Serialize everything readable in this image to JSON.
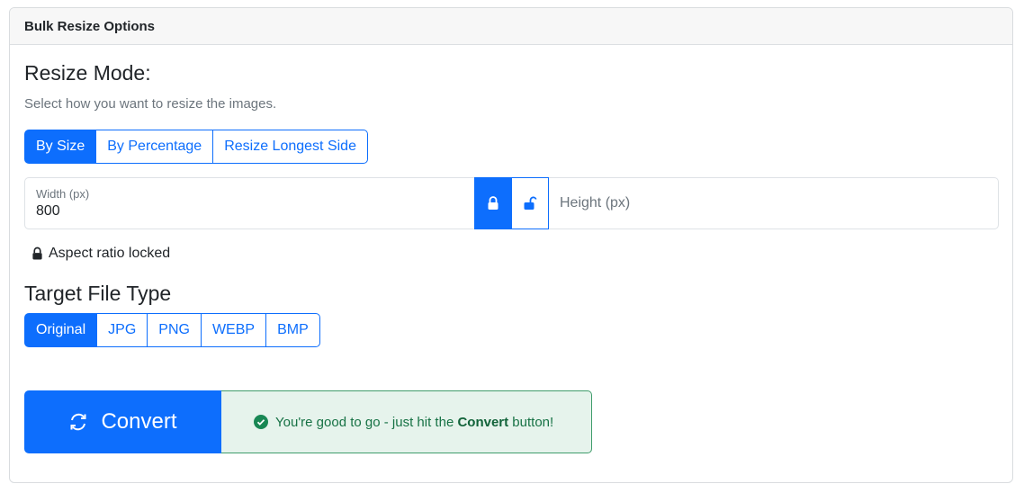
{
  "card": {
    "title": "Bulk Resize Options"
  },
  "resize_mode": {
    "heading": "Resize Mode:",
    "help": "Select how you want to resize the images.",
    "options": [
      "By Size",
      "By Percentage",
      "Resize Longest Side"
    ],
    "selected": "By Size"
  },
  "dimensions": {
    "width_label": "Width (px)",
    "width_value": "800",
    "height_placeholder": "Height (px)",
    "aspect_status": "Aspect ratio locked"
  },
  "file_type": {
    "heading": "Target File Type",
    "options": [
      "Original",
      "JPG",
      "PNG",
      "WEBP",
      "BMP"
    ],
    "selected": "Original"
  },
  "convert": {
    "button_label": "Convert",
    "message_prefix": "You're good to go - just hit the ",
    "message_bold": "Convert",
    "message_suffix": " button!"
  },
  "colors": {
    "primary": "#0d6efd",
    "success": "#198754",
    "success_bg": "#e6f3ec"
  },
  "icons": {
    "lock": "lock-icon",
    "unlock": "unlock-icon",
    "convert": "refresh-icon",
    "check": "check-circle-icon"
  }
}
